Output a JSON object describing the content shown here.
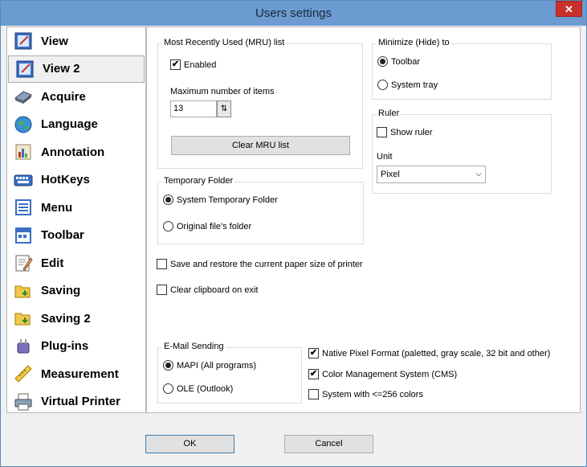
{
  "window": {
    "title": "Users settings",
    "close_label": "✕"
  },
  "sidebar": {
    "items": [
      {
        "label": "View"
      },
      {
        "label": "View 2"
      },
      {
        "label": "Acquire"
      },
      {
        "label": "Language"
      },
      {
        "label": "Annotation"
      },
      {
        "label": "HotKeys"
      },
      {
        "label": "Menu"
      },
      {
        "label": "Toolbar"
      },
      {
        "label": "Edit"
      },
      {
        "label": "Saving"
      },
      {
        "label": "Saving 2"
      },
      {
        "label": "Plug-ins"
      },
      {
        "label": "Measurement"
      },
      {
        "label": "Virtual Printer"
      }
    ]
  },
  "mru": {
    "title": "Most Recently Used (MRU) list",
    "enabled_label": "Enabled",
    "max_label": "Maximum number of items",
    "max_value": "13",
    "spin_glyph": "⇅",
    "clear_label": "Clear MRU list"
  },
  "minimize": {
    "title": "Minimize (Hide) to",
    "toolbar_label": "Toolbar",
    "tray_label": "System tray"
  },
  "ruler": {
    "title": "Ruler",
    "show_label": "Show ruler",
    "unit_label": "Unit",
    "unit_value": "Pixel",
    "arrow": "⌵"
  },
  "temp": {
    "title": "Temporary Folder",
    "system_label": "System Temporary Folder",
    "original_label": "Original file's folder"
  },
  "options": {
    "save_paper_label": "Save and restore the current paper size of printer",
    "clear_clipboard_label": "Clear clipboard on exit"
  },
  "email": {
    "title": "E-Mail Sending",
    "mapi_label": "MAPI (All programs)",
    "ole_label": "OLE (Outlook)"
  },
  "pixel": {
    "native_label": "Native Pixel Format (paletted, gray scale, 32 bit and other)",
    "cms_label": "Color Management System (CMS)",
    "colors256_label": "System with <=256 colors"
  },
  "check_glyph": "✔",
  "buttons": {
    "ok_label": "OK",
    "cancel_label": "Cancel"
  }
}
